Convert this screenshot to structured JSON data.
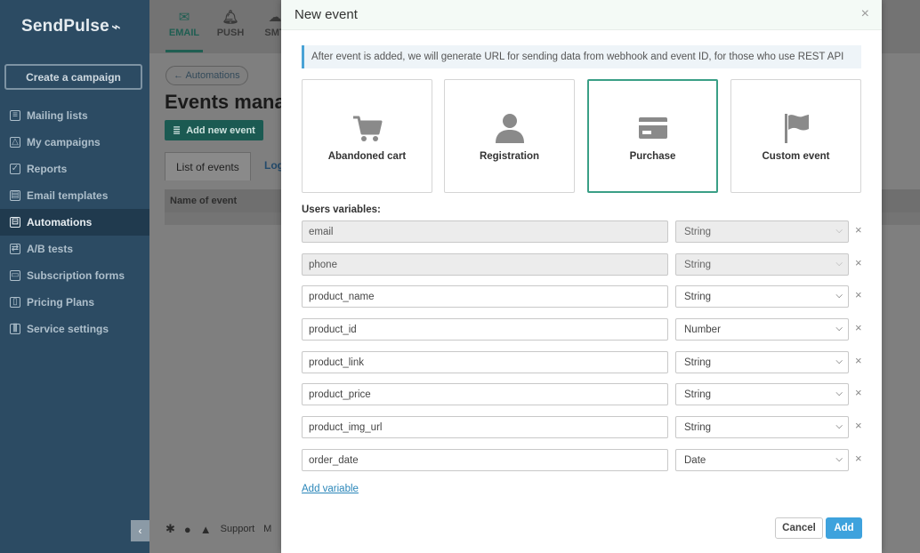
{
  "sidebar": {
    "logo": "SendPulse",
    "create_button": "Create a campaign",
    "items": [
      {
        "label": "Mailing lists",
        "icon": "list-icon"
      },
      {
        "label": "My campaigns",
        "icon": "campaign-icon"
      },
      {
        "label": "Reports",
        "icon": "reports-icon"
      },
      {
        "label": "Email templates",
        "icon": "template-icon"
      },
      {
        "label": "Automations",
        "icon": "automation-icon",
        "active": true
      },
      {
        "label": "A/B tests",
        "icon": "ab-icon"
      },
      {
        "label": "Subscription forms",
        "icon": "form-icon"
      },
      {
        "label": "Pricing Plans",
        "icon": "pricing-icon"
      },
      {
        "label": "Service settings",
        "icon": "settings-icon"
      }
    ]
  },
  "topnav": {
    "items": [
      {
        "label": "EMAIL",
        "icon": "email-icon"
      },
      {
        "label": "PUSH",
        "icon": "bell-icon"
      },
      {
        "label": "SMT",
        "icon": "cloud-icon"
      }
    ]
  },
  "main": {
    "breadcrumb": "← Automations",
    "title": "Events mana",
    "add_new_event": "Add new event",
    "tabs": [
      "List of events",
      "Log"
    ],
    "table_header": "Name of event",
    "footer_support": "Support",
    "footer_more": "M"
  },
  "modal": {
    "title": "New event",
    "close": "×",
    "info": "After event is added, we will generate URL for sending data from webhook and event ID, for those who use REST API",
    "event_types": [
      {
        "label": "Abandoned cart",
        "icon": "cart-icon"
      },
      {
        "label": "Registration",
        "icon": "user-icon"
      },
      {
        "label": "Purchase",
        "icon": "credit-card-icon",
        "selected": true
      },
      {
        "label": "Custom event",
        "icon": "flag-icon"
      }
    ],
    "vars_label": "Users variables:",
    "variables": [
      {
        "name": "email",
        "type": "String",
        "disabled": true
      },
      {
        "name": "phone",
        "type": "String",
        "disabled": true
      },
      {
        "name": "product_name",
        "type": "String",
        "disabled": false
      },
      {
        "name": "product_id",
        "type": "Number",
        "disabled": false
      },
      {
        "name": "product_link",
        "type": "String",
        "disabled": false
      },
      {
        "name": "product_price",
        "type": "String",
        "disabled": false
      },
      {
        "name": "product_img_url",
        "type": "String",
        "disabled": false
      },
      {
        "name": "order_date",
        "type": "Date",
        "disabled": false
      }
    ],
    "add_variable": "Add variable",
    "cancel": "Cancel",
    "add": "Add"
  },
  "colors": {
    "sidebar_bg": "#2c4b63",
    "accent_teal": "#3a9f86",
    "primary_blue": "#3ea2dd"
  }
}
